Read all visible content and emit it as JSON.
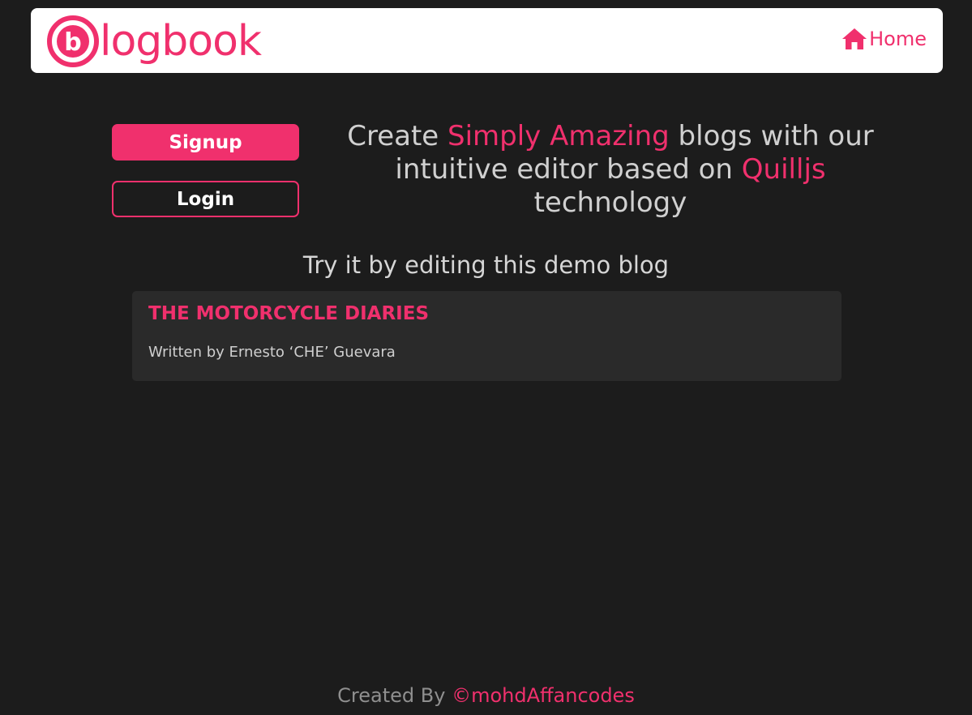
{
  "navbar": {
    "logo_text": "logbook",
    "logo_letter": "b",
    "home_label": "Home"
  },
  "actions": {
    "signup_label": "Signup",
    "login_label": "Login"
  },
  "hero": {
    "part1": "Create ",
    "accent1": "Simply Amazing",
    "part2": " blogs with our intuitive editor based on ",
    "accent2": "Quilljs",
    "part3": " technology"
  },
  "demo": {
    "heading": "Try it by editing this demo blog",
    "blog": {
      "title": "THE MOTORCYCLE DIARIES",
      "author": "Written by Ernesto ‘CHE’ Guevara"
    }
  },
  "footer": {
    "prefix": "Created By ",
    "author": "©mohdAffancodes"
  },
  "colors": {
    "accent": "#f0306d",
    "background": "#1c1c1c",
    "card": "#2a2a2a"
  }
}
